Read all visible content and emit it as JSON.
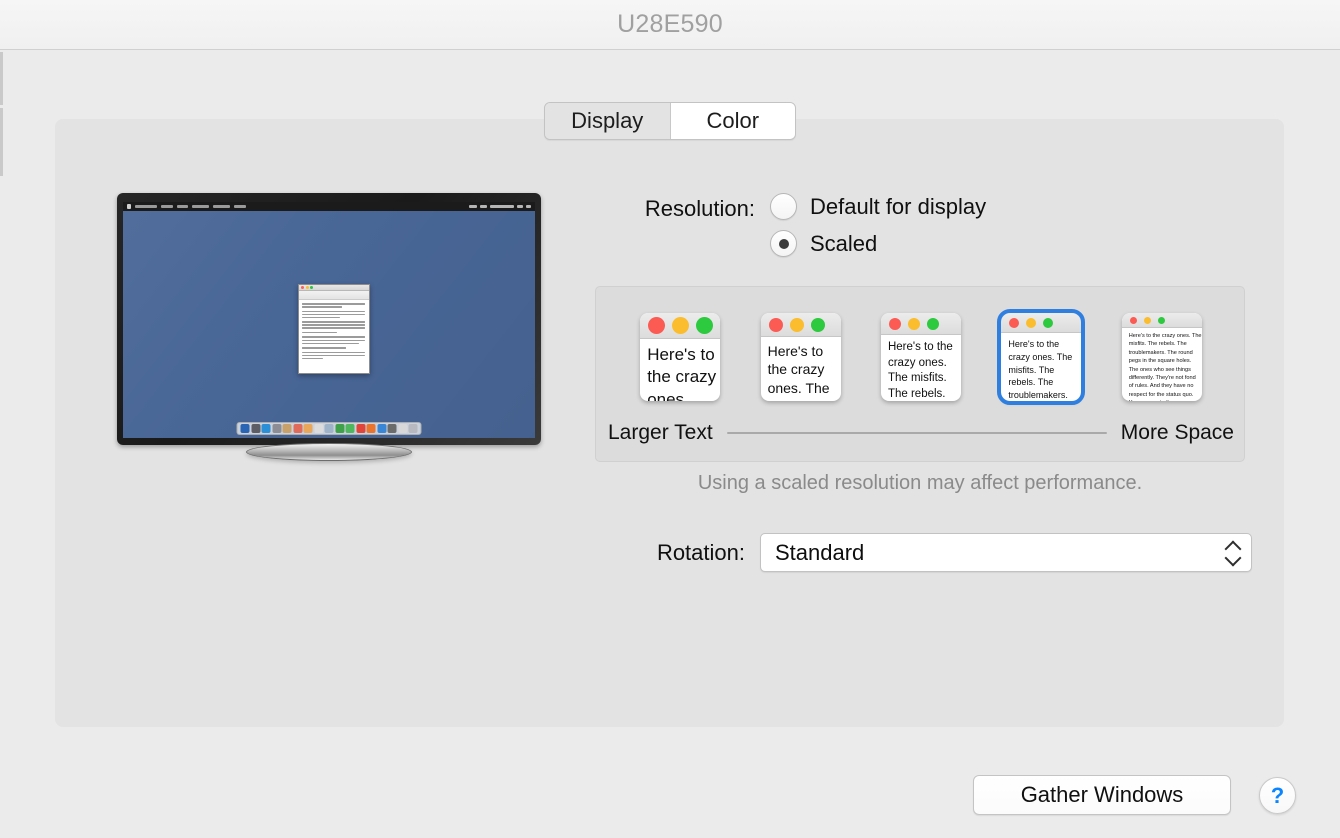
{
  "window": {
    "title": "U28E590"
  },
  "tabs": [
    {
      "label": "Display",
      "state": "active"
    },
    {
      "label": "Color",
      "state": "hovered"
    }
  ],
  "resolution": {
    "label": "Resolution:",
    "options": [
      {
        "label": "Default for display",
        "selected": false
      },
      {
        "label": "Scaled",
        "selected": true
      }
    ]
  },
  "scaled": {
    "slider_left_label": "Larger Text",
    "slider_right_label": "More Space",
    "performance_note": "Using a scaled resolution may affect performance.",
    "selected_index": 3,
    "thumbnails": [
      {
        "text": "Here's to the crazy ones. The misfits. The rebels. The troublemakers.",
        "selected": false
      },
      {
        "text": "Here's to the crazy ones. The misfits. The rebels. The troublemakers. The round pegs in the square holes.",
        "selected": false
      },
      {
        "text": "Here's to the crazy ones. The misfits. The rebels. The troublemakers. The round pegs in the square holes. The ones who see things differently.",
        "selected": false
      },
      {
        "text": "Here's to the crazy ones. The misfits. The rebels. The troublemakers. The round pegs in the square holes. The ones who see things differently. They're not fond of rules. And they have no respect for the status quo.",
        "selected": true
      },
      {
        "text": "Here's to the crazy ones. The misfits. The rebels. The troublemakers. The round pegs in the square holes. The ones who see things differently. They're not fond of rules. And they have no respect for the status quo. You can quote them, disagree with them, glorify or vilify them. About the only thing you can't do is ignore them. Because they change things.",
        "selected": false
      }
    ]
  },
  "rotation": {
    "label": "Rotation:",
    "value": "Standard"
  },
  "footer": {
    "gather_windows_label": "Gather Windows",
    "help_label": "?"
  },
  "preview": {
    "desktop_color": "#486696",
    "dock_icon_colors": [
      "#2a64b4",
      "#5d5d66",
      "#2a8fd6",
      "#8d8d95",
      "#c8a06a",
      "#e06b5a",
      "#e8a75a",
      "#dcdcdc",
      "#9fb4c8",
      "#3fa14a",
      "#4fb85e",
      "#e0443a",
      "#e8742e",
      "#3a86d6",
      "#6b6b6b",
      "#d8d8d8",
      "#b8b8c0"
    ]
  },
  "colors": {
    "accent_blue": "#2f7fe0",
    "help_blue": "#0a84ff",
    "traffic_red": "#fc5b54",
    "traffic_yellow": "#fbbd2e",
    "traffic_green": "#2dc93f",
    "window_bg": "#ebebeb",
    "panel_bg": "#e3e3e3"
  }
}
